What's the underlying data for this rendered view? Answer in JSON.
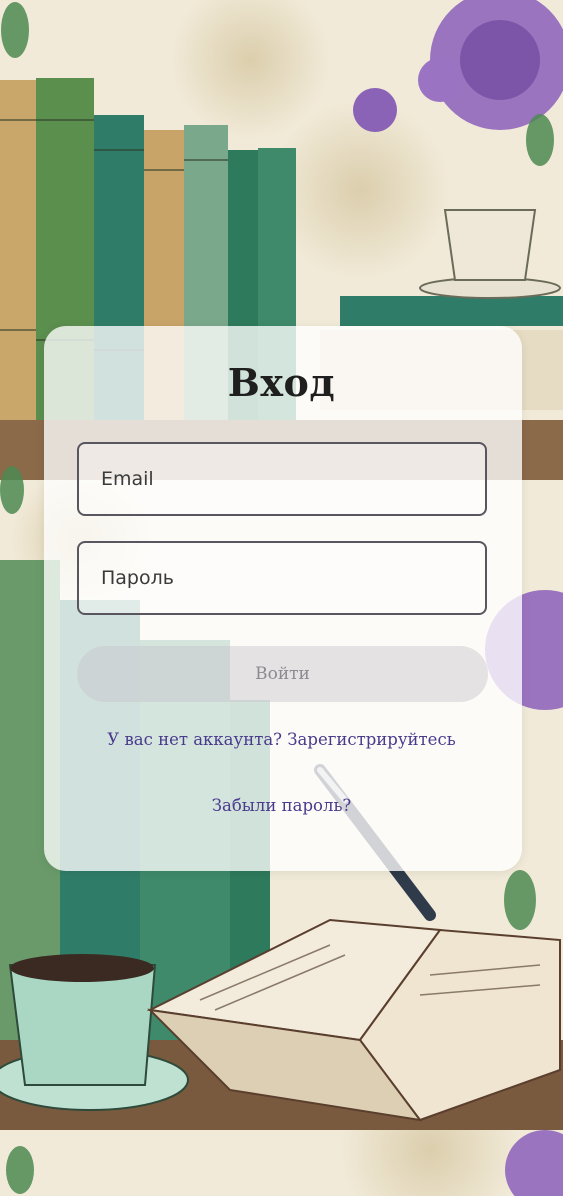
{
  "login": {
    "title": "Вход",
    "email_placeholder": "Email",
    "password_placeholder": "Пароль",
    "submit_label": "Войти",
    "register_link": "У вас нет аккаунта? Зарегистрируйтесь",
    "forgot_link": "Забыли пароль?"
  },
  "theme": {
    "link_color": "#4a3a8c",
    "field_border": "#5a5660",
    "button_disabled_text": "#8c8a8f"
  },
  "background": {
    "description_icons": [
      "bookshelf-illustration",
      "peony-flowers",
      "teacup",
      "open-book",
      "fountain-pen"
    ]
  }
}
